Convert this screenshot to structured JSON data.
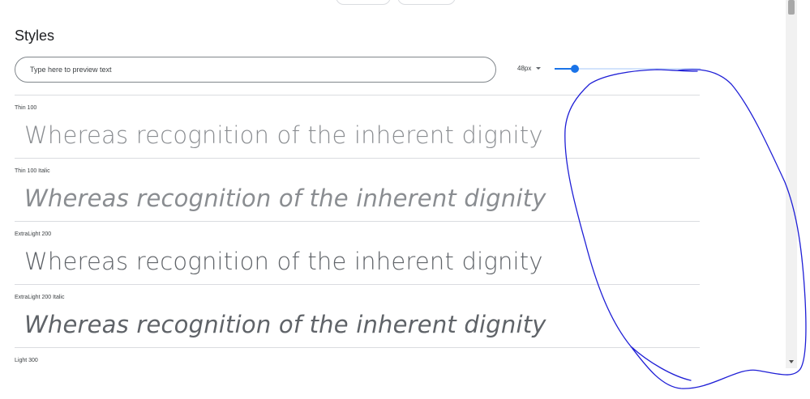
{
  "section": {
    "heading": "Styles"
  },
  "preview": {
    "placeholder": "Type here to preview text"
  },
  "size_control": {
    "selected": "48px",
    "slider_fraction": 0.14
  },
  "styles": [
    {
      "label": "Thin 100",
      "sample": "Whereas recognition of the inherent dignity"
    },
    {
      "label": "Thin 100 Italic",
      "sample": "Whereas recognition of the inherent dignity"
    },
    {
      "label": "ExtraLight 200",
      "sample": "Whereas recognition of the inherent dignity"
    },
    {
      "label": "ExtraLight 200 Italic",
      "sample": "Whereas recognition of the inherent dignity"
    },
    {
      "label": "Light 300",
      "sample": ""
    }
  ],
  "colors": {
    "accent": "#1a73e8",
    "annotation_stroke": "#1f1fd6"
  }
}
